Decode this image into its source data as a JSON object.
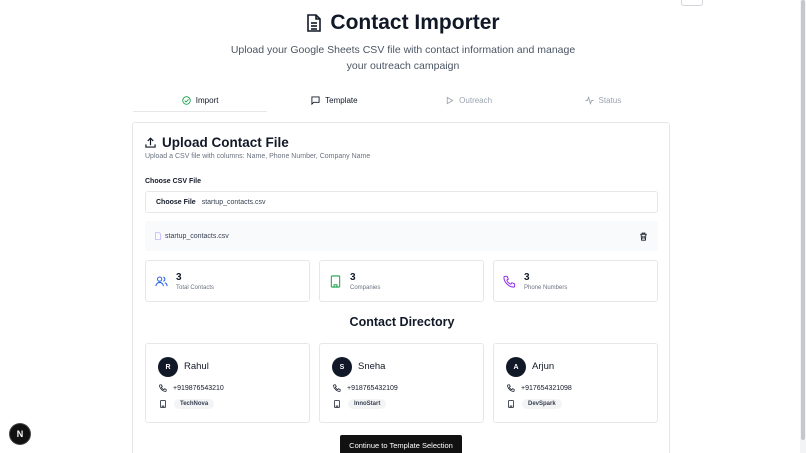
{
  "header": {
    "title": "Contact Importer",
    "subtitle": "Upload your Google Sheets CSV file with contact information and manage your outreach campaign"
  },
  "tabs": [
    {
      "label": "Import",
      "icon": "check-circle-icon",
      "state": "active"
    },
    {
      "label": "Template",
      "icon": "message-square-icon",
      "state": "enabled"
    },
    {
      "label": "Outreach",
      "icon": "play-icon",
      "state": "disabled"
    },
    {
      "label": "Status",
      "icon": "activity-icon",
      "state": "disabled"
    }
  ],
  "upload": {
    "title": "Upload Contact File",
    "description": "Upload a CSV file with columns: Name, Phone Number, Company Name",
    "field_label": "Choose CSV File",
    "choose_button": "Choose File",
    "selected_file": "startup_contacts.csv",
    "uploaded_file": "startup_contacts.csv"
  },
  "stats": [
    {
      "value": "3",
      "label": "Total Contacts",
      "icon": "users-icon",
      "color": "#2563eb"
    },
    {
      "value": "3",
      "label": "Companies",
      "icon": "building-icon",
      "color": "#16a34a"
    },
    {
      "value": "3",
      "label": "Phone Numbers",
      "icon": "phone-icon",
      "color": "#9333ea"
    }
  ],
  "directory": {
    "title": "Contact Directory",
    "contacts": [
      {
        "initial": "R",
        "name": "Rahul",
        "phone": "+919876543210",
        "company": "TechNova"
      },
      {
        "initial": "S",
        "name": "Sneha",
        "phone": "+918765432109",
        "company": "InnoStart"
      },
      {
        "initial": "A",
        "name": "Arjun",
        "phone": "+917654321098",
        "company": "DevSpark"
      }
    ]
  },
  "actions": {
    "continue_label": "Continue to Template Selection"
  },
  "dev_badge": "N"
}
